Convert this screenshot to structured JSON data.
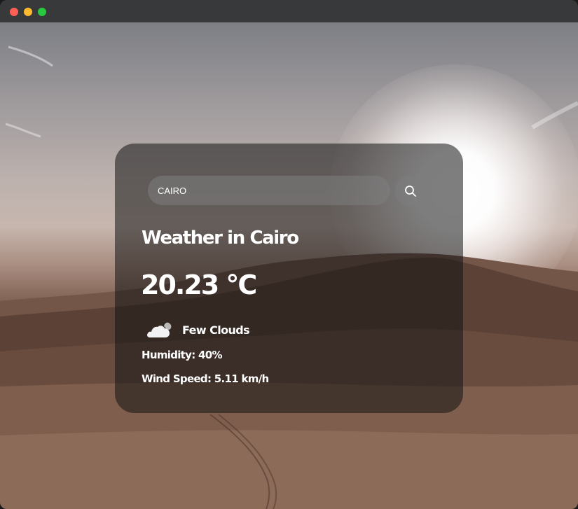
{
  "search": {
    "value": "CAIRO",
    "placeholder": "Search",
    "icon": "search-icon"
  },
  "weather": {
    "heading": "Weather in Cairo",
    "temperature": "20.23 °C",
    "condition_icon": "cloud-icon",
    "condition": "Few Clouds",
    "humidity": "Humidity: 40%",
    "wind": "Wind Speed: 5.11 km/h"
  },
  "colors": {
    "card_background": "#1414148c",
    "text": "#ffffff",
    "input_background": "#7d7d7d8c",
    "close_button": "#fe5f57",
    "minimize_button": "#febc2e",
    "zoom_button": "#28c840"
  }
}
